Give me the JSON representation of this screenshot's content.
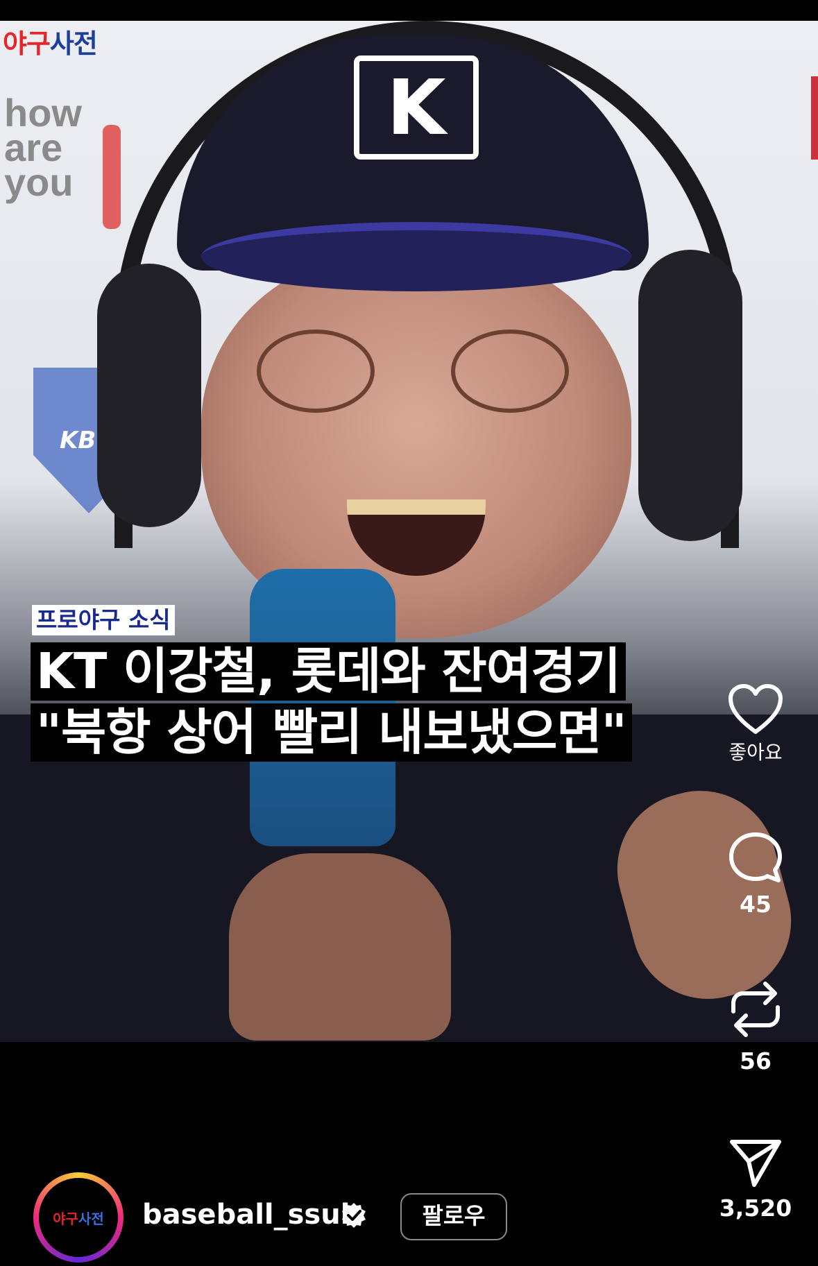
{
  "brand": {
    "logo_a": "야구",
    "logo_b": "사전"
  },
  "video": {
    "background_sign": "how\nare\nyou",
    "background_badge": "KB",
    "cap_logo": "K"
  },
  "overlay": {
    "tag": "프로야구 소식",
    "headline_line1": "KT 이강철, 롯데와 잔여경기",
    "headline_line2": "\"북항 상어 빨리 내보냈으면\""
  },
  "actions": {
    "like_label": "좋아요",
    "comment_count": "45",
    "repost_count": "56",
    "share_count": "3,520"
  },
  "author": {
    "avatar_a": "야구",
    "avatar_b": "사전",
    "username": "baseball_ssul",
    "follow_label": "팔로우"
  },
  "colors": {
    "brand_red": "#e8232a",
    "brand_blue": "#1d3e9c",
    "tag_text": "#1a2a8c"
  },
  "icons": [
    "heart-icon",
    "comment-icon",
    "repost-icon",
    "share-icon",
    "verified-badge-icon"
  ]
}
